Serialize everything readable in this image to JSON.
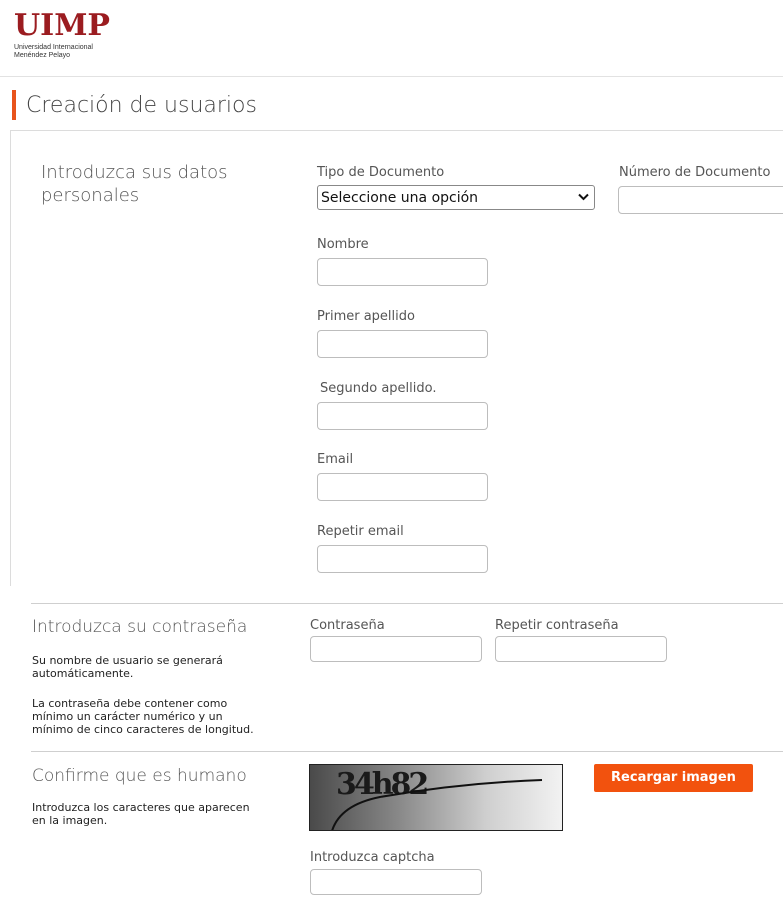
{
  "header": {
    "logo_text": "UIMP",
    "logo_sub_line1": "Universidad Internacional",
    "logo_sub_line2": "Menéndez Pelayo",
    "page_title": "Creación de usuarios",
    "accent_color": "#e8541c"
  },
  "personal": {
    "section_title_line1": "Introduzca sus datos",
    "section_title_line2": "personales",
    "tipo_documento_label": "Tipo de Documento",
    "tipo_documento_selected": "Seleccione una opción",
    "numero_documento_label": "Número de Documento",
    "nombre_label": "Nombre",
    "primer_apellido_label": "Primer apellido",
    "segundo_apellido_label": "Segundo apellido.",
    "email_label": "Email",
    "repetir_email_label": "Repetir email"
  },
  "password": {
    "section_title": "Introduzca su contraseña",
    "note1_line1": "Su nombre de usuario se generará",
    "note1_line2": "automáticamente.",
    "note2_line1": "La contraseña debe contener como",
    "note2_line2": "mínimo un carácter numérico y un",
    "note2_line3": "mínimo de cinco caracteres de longitud.",
    "contrasena_label": "Contraseña",
    "repetir_contrasena_label": "Repetir contraseña"
  },
  "captcha": {
    "section_title": "Confirme que es humano",
    "note_line1": "Introduzca los caracteres que aparecen",
    "note_line2": "en la imagen.",
    "captcha_text": "34h82",
    "reload_button": "Recargar imagen",
    "button_color": "#f2520e",
    "captcha_input_label": "Introduzca captcha"
  }
}
